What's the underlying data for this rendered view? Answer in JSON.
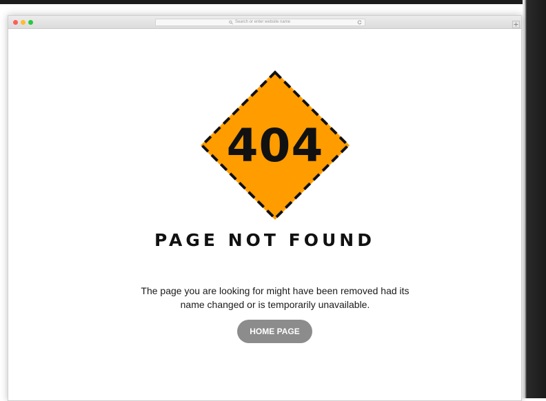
{
  "browser": {
    "address_placeholder": "Search or enter website name",
    "icons": {
      "search": "magnifier-icon",
      "reload": "reload-icon",
      "new_tab": "plus-icon"
    }
  },
  "error": {
    "code": "404",
    "title": "PAGE NOT FOUND",
    "message": "The page you are looking for might have been removed had its name changed or is temporarily unavailable.",
    "button_label": "HOME PAGE"
  },
  "colors": {
    "sign_fill": "#ff9c00",
    "sign_border": "#111111",
    "button_bg": "#8c8c8c",
    "text": "#111111"
  }
}
